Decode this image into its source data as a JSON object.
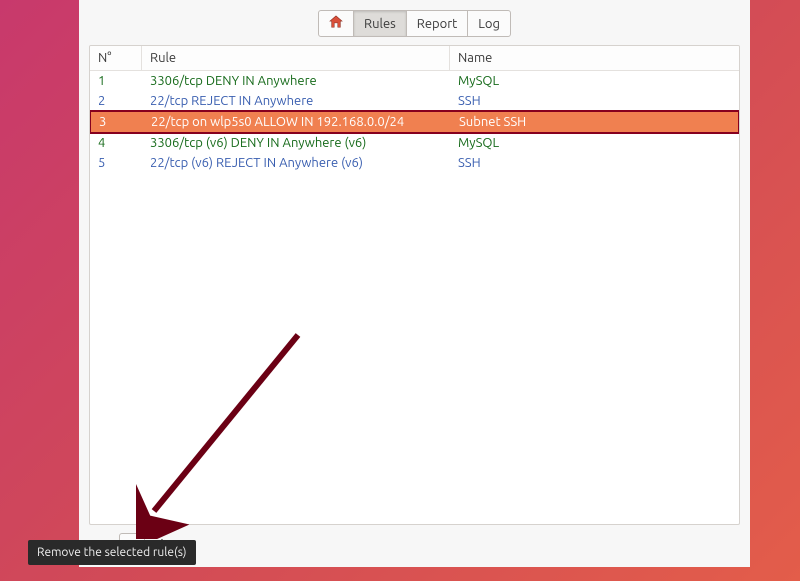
{
  "tabs": {
    "home": "",
    "rules": "Rules",
    "report": "Report",
    "log": "Log"
  },
  "headers": {
    "n": "N°",
    "rule": "Rule",
    "name": "Name"
  },
  "rules": [
    {
      "n": "1",
      "rule": "3306/tcp DENY IN Anywhere",
      "name": "MySQL",
      "cls": "deny"
    },
    {
      "n": "2",
      "rule": "22/tcp REJECT IN Anywhere",
      "name": "SSH",
      "cls": "reject"
    },
    {
      "n": "3",
      "rule": "22/tcp on wlp5s0 ALLOW IN 192.168.0.0/24",
      "name": "Subnet SSH",
      "cls": "allow",
      "selected": true
    },
    {
      "n": "4",
      "rule": "3306/tcp (v6) DENY IN Anywhere (v6)",
      "name": "MySQL",
      "cls": "deny"
    },
    {
      "n": "5",
      "rule": "22/tcp (v6) REJECT IN Anywhere (v6)",
      "name": "SSH",
      "cls": "reject"
    }
  ],
  "actions": {
    "add": "+",
    "remove": "−",
    "settings": "⚙"
  },
  "tooltip": "Remove the selected rule(s)"
}
